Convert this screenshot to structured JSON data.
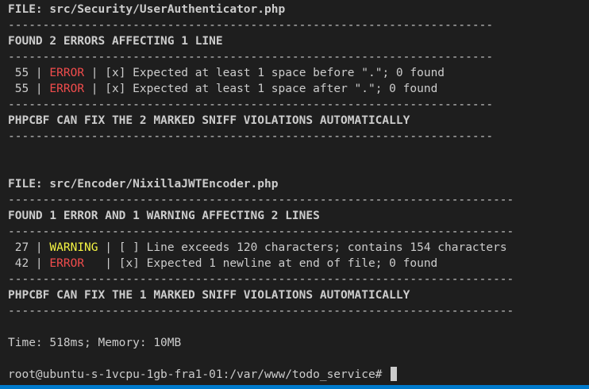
{
  "report1": {
    "file_line": "FILE: src/Security/UserAuthenticator.php",
    "rule": "----------------------------------------------------------------------",
    "summary": "FOUND 2 ERRORS AFFECTING 1 LINE",
    "rows": [
      {
        "num": " 55",
        "sep1": " | ",
        "level": "ERROR",
        "sep2": " | ",
        "msg": "[x] Expected at least 1 space before \".\"; 0 found"
      },
      {
        "num": " 55",
        "sep1": " | ",
        "level": "ERROR",
        "sep2": " | ",
        "msg": "[x] Expected at least 1 space after \".\"; 0 found"
      }
    ],
    "fix_note": "PHPCBF CAN FIX THE 2 MARKED SNIFF VIOLATIONS AUTOMATICALLY"
  },
  "report2": {
    "file_line": "FILE: src/Encoder/NixillaJWTEncoder.php",
    "rule": "-------------------------------------------------------------------------",
    "summary": "FOUND 1 ERROR AND 1 WARNING AFFECTING 2 LINES",
    "rows": [
      {
        "num": " 27",
        "sep1": " | ",
        "level": "WARNING",
        "sep2": " | ",
        "msg": "[ ] Line exceeds 120 characters; contains 154 characters"
      },
      {
        "num": " 42",
        "sep1": " | ",
        "level": "ERROR  ",
        "sep2": " | ",
        "msg": "[x] Expected 1 newline at end of file; 0 found"
      }
    ],
    "fix_note": "PHPCBF CAN FIX THE 1 MARKED SNIFF VIOLATIONS AUTOMATICALLY"
  },
  "stats": "Time: 518ms; Memory: 10MB",
  "prompt": "root@ubuntu-s-1vcpu-1gb-fra1-01:/var/www/todo_service#",
  "colors": {
    "background": "#1e1e1e",
    "text": "#cccccc",
    "error": "#f14c4c",
    "warning": "#f5f543",
    "statusbar": "#007acc"
  }
}
